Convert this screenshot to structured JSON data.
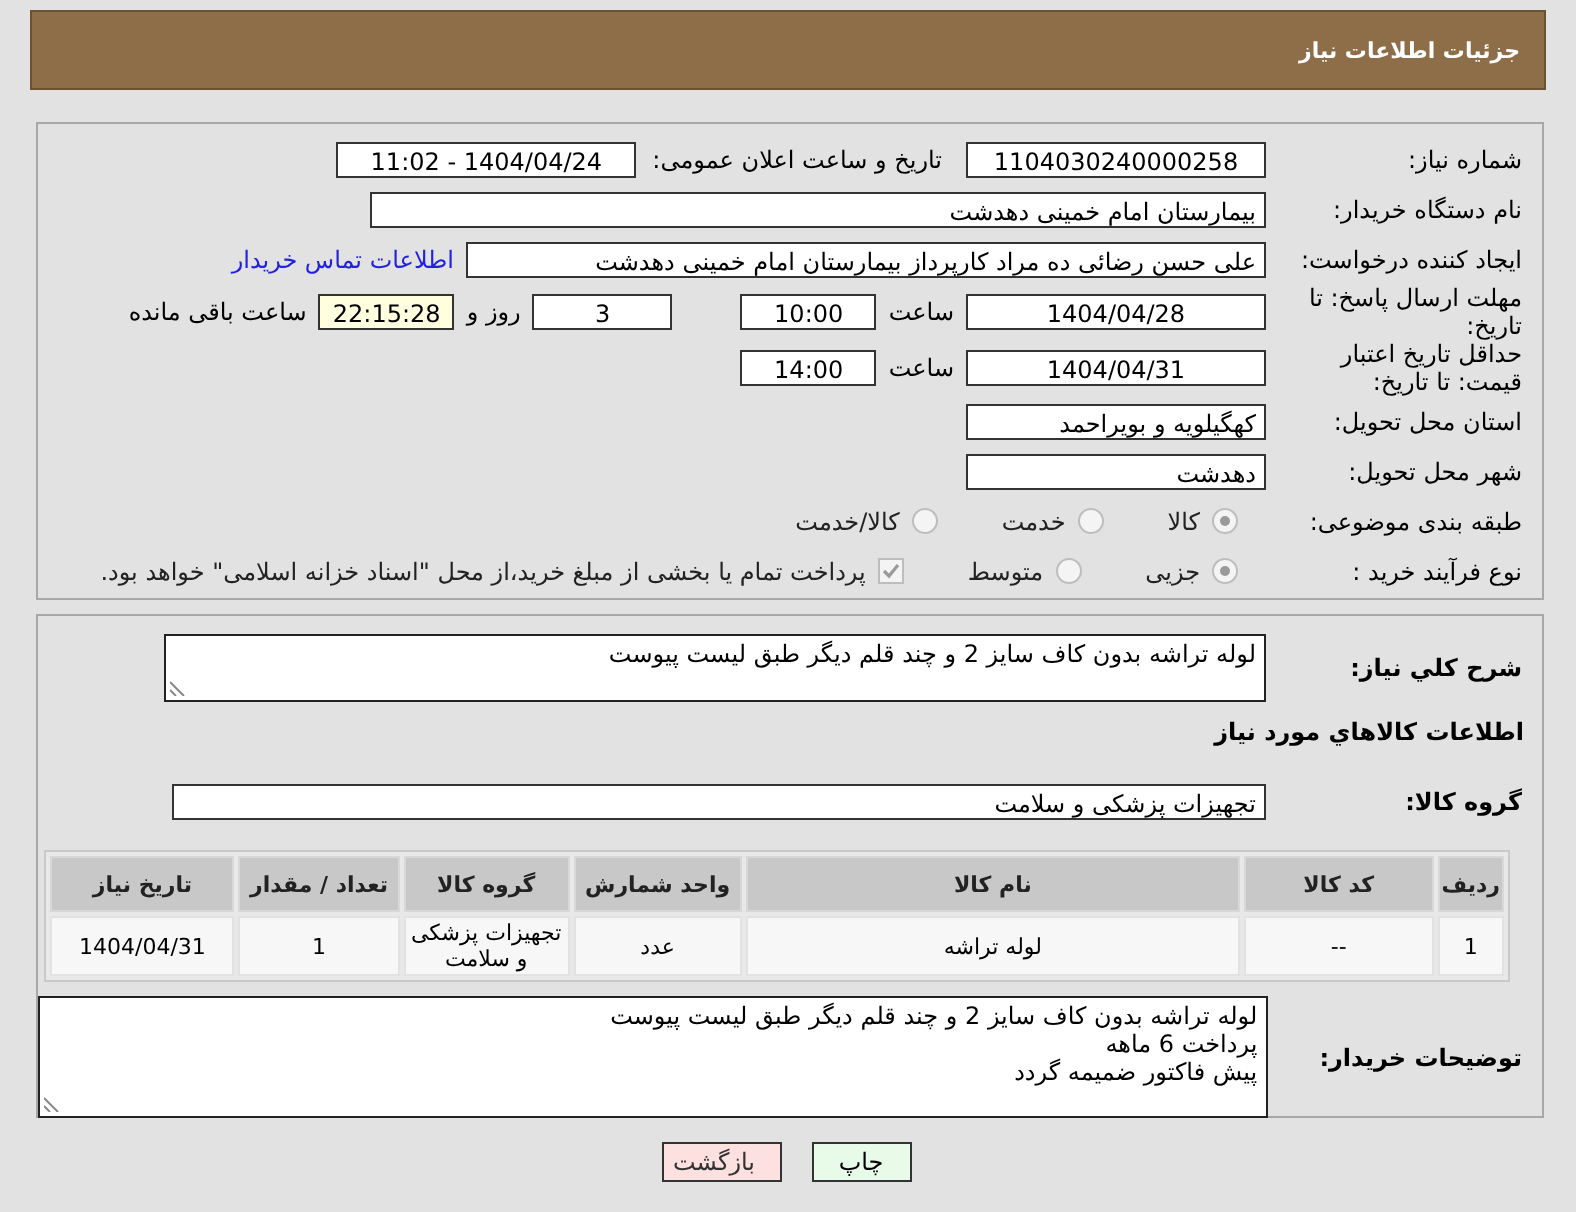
{
  "header": {
    "title": "جزئیات اطلاعات نیاز"
  },
  "details": {
    "need_number": {
      "label": "شماره نیاز:",
      "value": "1104030240000258"
    },
    "announce": {
      "label": "تاریخ و ساعت اعلان عمومی:",
      "value": "1404/04/24 - 11:02"
    },
    "buyer_org": {
      "label": "نام دستگاه خریدار:",
      "value": "بیمارستان امام خمینی دهدشت"
    },
    "creator": {
      "label": "ایجاد کننده درخواست:",
      "value": "علی حسن رضائی ده مراد کارپرداز بیمارستان امام خمینی دهدشت",
      "link": "اطلاعات تماس خریدار"
    },
    "deadline": {
      "label": "مهلت ارسال پاسخ: تا تاریخ:",
      "date": "1404/04/28",
      "time_label": "ساعت",
      "time": "10:00",
      "days": "3",
      "days_label": "روز و",
      "remaining": "22:15:28",
      "remaining_label": "ساعت باقی مانده"
    },
    "validity": {
      "label": "حداقل تاریخ اعتبار قیمت: تا تاریخ:",
      "date": "1404/04/31",
      "time_label": "ساعت",
      "time": "14:00"
    },
    "province": {
      "label": "استان محل تحویل:",
      "value": "کهگیلویه و بویراحمد"
    },
    "city": {
      "label": "شهر محل تحویل:",
      "value": "دهدشت"
    },
    "category": {
      "label": "طبقه بندی موضوعی:",
      "options": [
        {
          "label": "کالا",
          "selected": true
        },
        {
          "label": "خدمت",
          "selected": false
        },
        {
          "label": "کالا/خدمت",
          "selected": false
        }
      ]
    },
    "process": {
      "label": "نوع فرآیند خرید :",
      "options": [
        {
          "label": "جزیی",
          "selected": true
        },
        {
          "label": "متوسط",
          "selected": false
        }
      ],
      "treasury": {
        "label": "پرداخت تمام یا بخشی از مبلغ خرید،از محل \"اسناد خزانه اسلامی\" خواهد بود.",
        "checked": true
      }
    }
  },
  "goods": {
    "summary": {
      "label": "شرح کلي نياز:",
      "value": "لوله تراشه بدون کاف سایز 2 و چند قلم دیگر طبق لیست پیوست"
    },
    "section_title": "اطلاعات كالاهاي مورد نياز",
    "group": {
      "label": "گروه کالا:",
      "value": "تجهیزات پزشکی و سلامت"
    },
    "table": {
      "columns": [
        "ردیف",
        "کد کالا",
        "نام کالا",
        "واحد شمارش",
        "گروه کالا",
        "تعداد / مقدار",
        "تاریخ نیاز"
      ],
      "rows": [
        [
          "1",
          "--",
          "لوله تراشه",
          "عدد",
          "تجهیزات پزشکی و سلامت",
          "1",
          "1404/04/31"
        ]
      ]
    },
    "notes": {
      "label": "توضیحات خریدار:",
      "lines": [
        "لوله تراشه بدون کاف سایز 2 و چند قلم دیگر طبق لیست پیوست",
        "پرداخت 6 ماهه",
        "پیش فاکتور ضمیمه گردد"
      ]
    }
  },
  "buttons": [
    {
      "label": "چاپ",
      "kind": "print"
    },
    {
      "label": "بازگشت",
      "kind": "back"
    }
  ]
}
